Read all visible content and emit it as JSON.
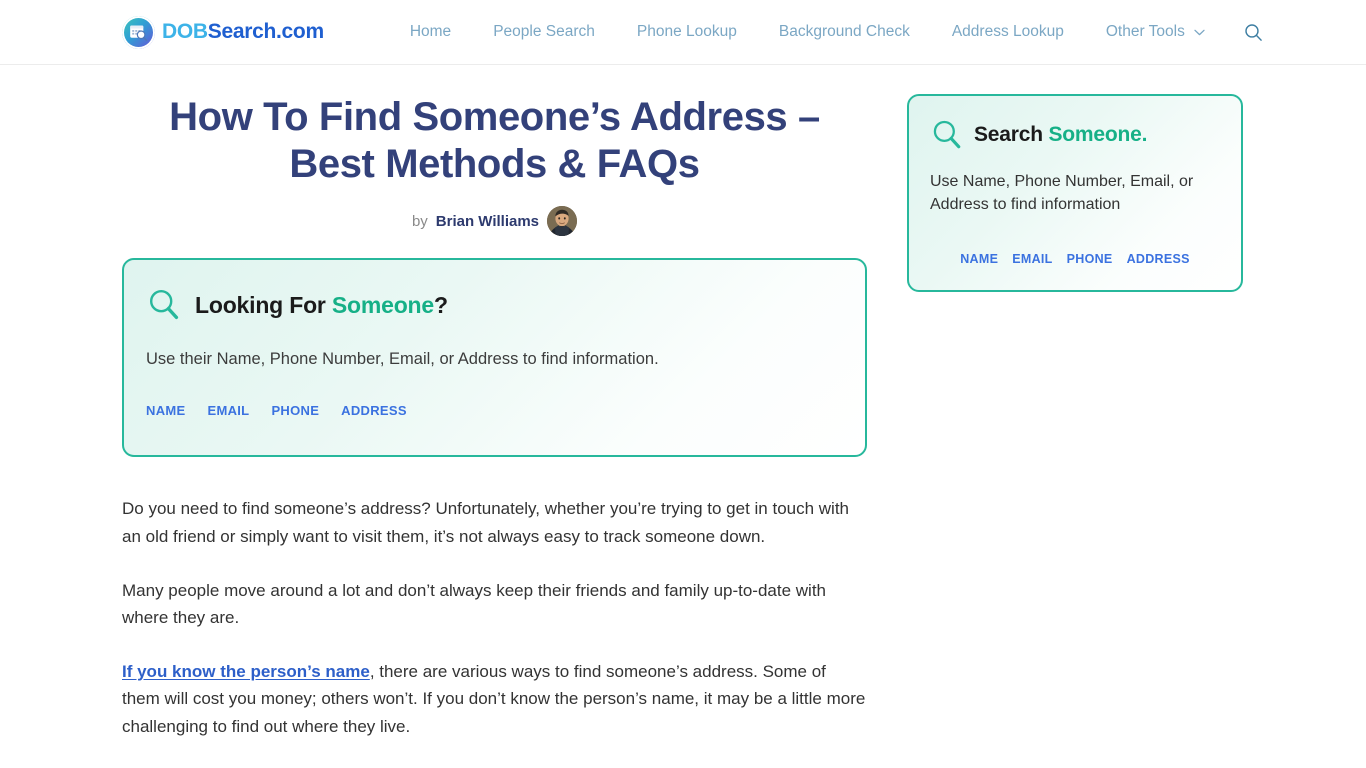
{
  "header": {
    "brand": {
      "name_part1": "DOB",
      "name_part2": "Search.com",
      "logo_icon": "calendar-magnifier-logo-icon"
    },
    "nav_items": [
      {
        "label": "Home",
        "has_caret": false
      },
      {
        "label": "People Search",
        "has_caret": false
      },
      {
        "label": "Phone Lookup",
        "has_caret": false
      },
      {
        "label": "Background Check",
        "has_caret": false
      },
      {
        "label": "Address Lookup",
        "has_caret": false
      },
      {
        "label": "Other Tools",
        "has_caret": true
      }
    ],
    "search_icon": "search-icon",
    "nav_link_color": "#7ba7c4"
  },
  "article": {
    "title": "How To Find Someone’s Address – Best Methods & FAQs",
    "title_color": "#33417a",
    "byline": {
      "prefix": "by",
      "author": "Brian Williams",
      "avatar_alt": "author-avatar"
    },
    "paragraphs": [
      {
        "id": "p1",
        "text": "Do you need to find someone’s address? Unfortunately, whether you’re trying to get in touch with an old friend or simply want to visit them, it’s not always easy to track someone down."
      },
      {
        "id": "p2",
        "text": "Many people move around a lot and don’t always keep their friends and family up-to-date with where they are."
      },
      {
        "id": "p3",
        "link_text": "If you know the person’s name",
        "text": ", there are various ways to find someone’s address. Some of them will cost you money; others won’t. If you don’t know the person’s name, it may be a little more challenging to find out where they live."
      }
    ]
  },
  "main_search_widget": {
    "icon": "search-icon",
    "title_lead": "Looking For ",
    "title_highlight": "Someone",
    "title_tail": "?",
    "subtitle": "Use their Name, Phone Number, Email, or Address to find information.",
    "tabs": [
      "NAME",
      "EMAIL",
      "PHONE",
      "ADDRESS"
    ],
    "border_color": "#27b89c",
    "highlight_color": "#16b087",
    "tab_color": "#3b72e0"
  },
  "sidebar_search_widget": {
    "icon": "search-icon",
    "title_lead": "Search ",
    "title_highlight": "Someone.",
    "title_tail": "",
    "subtitle": "Use Name, Phone Number, Email, or Address to find information",
    "tabs": [
      "NAME",
      "EMAIL",
      "PHONE",
      "ADDRESS"
    ],
    "border_color": "#27b89c",
    "highlight_color": "#16b087",
    "tab_color": "#3b72e0"
  }
}
